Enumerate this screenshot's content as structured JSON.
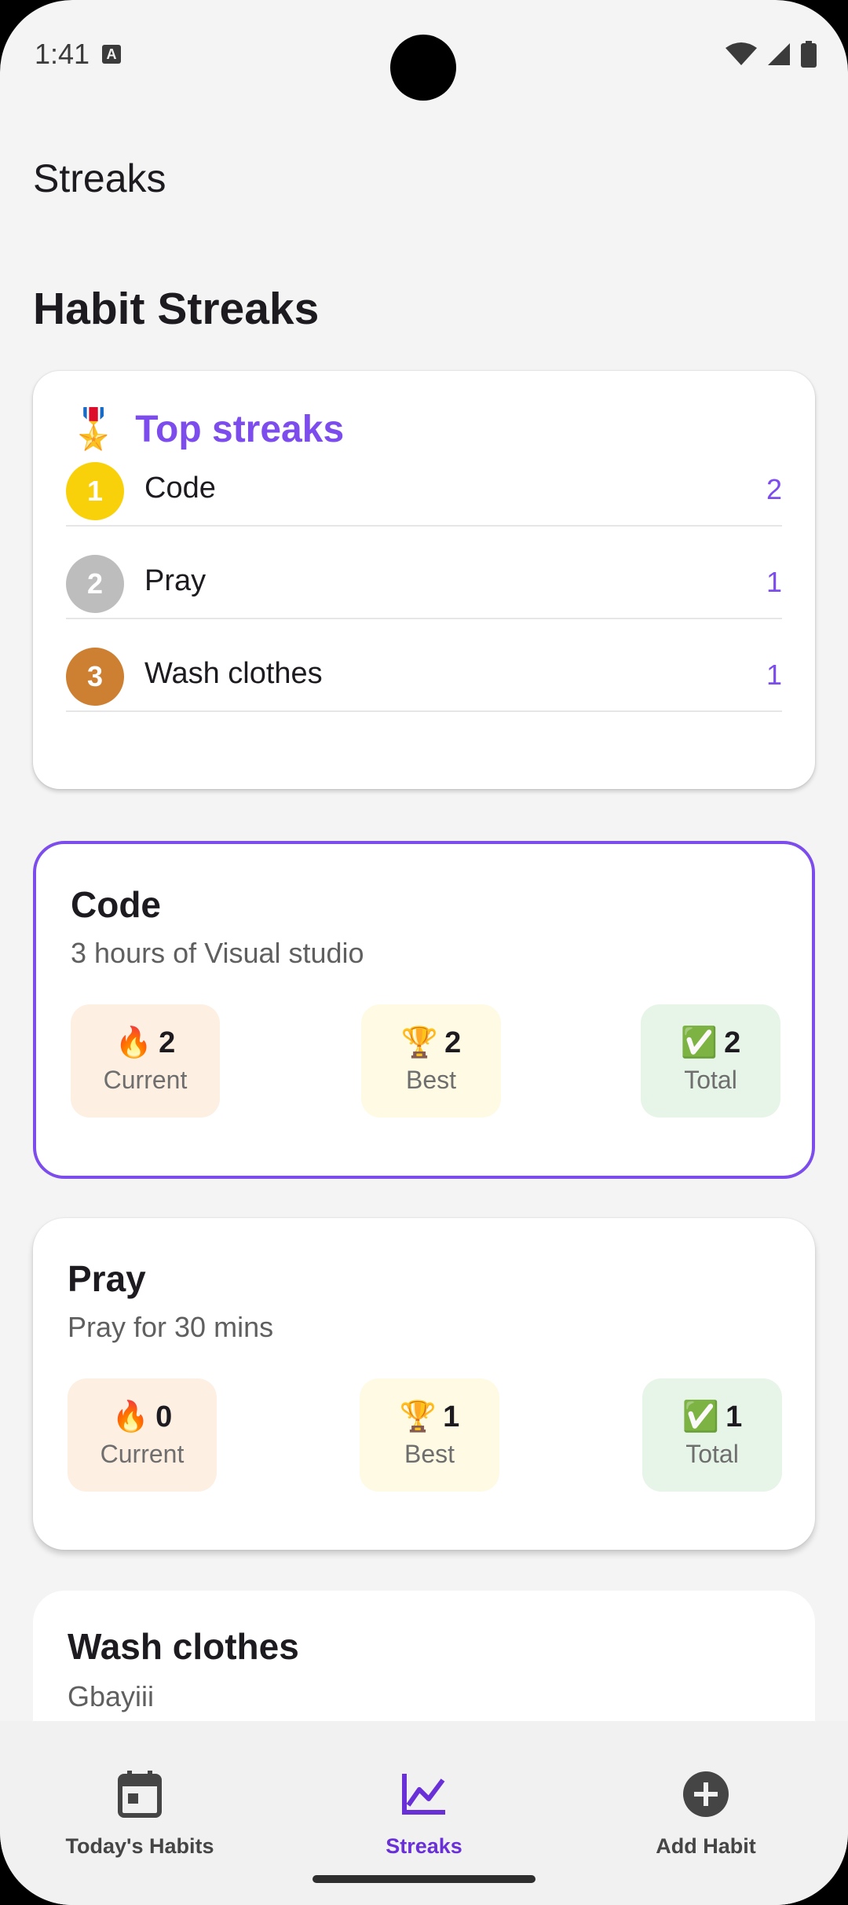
{
  "status_bar": {
    "time": "1:41"
  },
  "app_bar": {
    "title": "Streaks"
  },
  "page_title": "Habit Streaks",
  "top_streaks": {
    "title": "Top streaks",
    "items": [
      {
        "rank": "1",
        "name": "Code",
        "value": "2",
        "color": "#f9d10a"
      },
      {
        "rank": "2",
        "name": "Pray",
        "value": "1",
        "color": "#bdbdbd"
      },
      {
        "rank": "3",
        "name": "Wash clothes",
        "value": "1",
        "color": "#cd7f32"
      }
    ]
  },
  "habits": [
    {
      "name": "Code",
      "description": "3 hours of Visual studio",
      "current": "2",
      "best": "2",
      "total": "2"
    },
    {
      "name": "Pray",
      "description": "Pray for 30 mins",
      "current": "0",
      "best": "1",
      "total": "1"
    },
    {
      "name": "Wash clothes",
      "description": "Gbayiii"
    }
  ],
  "stat_labels": {
    "current": "Current",
    "best": "Best",
    "total": "Total"
  },
  "nav": {
    "items": [
      {
        "label": "Today's Habits",
        "icon": "calendar-icon"
      },
      {
        "label": "Streaks",
        "icon": "chart-icon"
      },
      {
        "label": "Add Habit",
        "icon": "add-circle-icon"
      }
    ]
  },
  "colors": {
    "accent": "#7c4dec",
    "nav_active": "#6a30d8"
  }
}
